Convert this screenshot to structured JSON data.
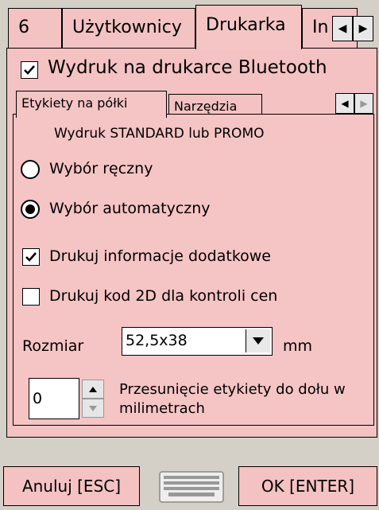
{
  "outer_tabs": [
    "6",
    "Użytkownicy",
    "Drukarka",
    "In"
  ],
  "bluetooth_label": "Wydruk na drukarce Bluetooth",
  "inner_tabs": [
    "Etykiety na półki",
    "Narzędzia"
  ],
  "section_title": "Wydruk STANDARD lub PROMO",
  "radio_manual": "Wybór ręczny",
  "radio_auto": "Wybór automatyczny",
  "check_extra_info": "Drukuj informacje dodatkowe",
  "check_2d_code": "Drukuj kod 2D dla kontroli cen",
  "size_label": "Rozmiar",
  "size_value": "52,5x38",
  "size_unit": "mm",
  "offset_value": "0",
  "offset_label": "Przesunięcie etykiety do dołu w milimetrach",
  "cancel_label": "Anuluj [ESC]",
  "ok_label": "OK [ENTER]",
  "colors": {
    "panel": "#f4c2c2",
    "chrome": "#d4d0c8"
  },
  "state": {
    "bluetooth_checked": true,
    "radio_selected": "auto",
    "extra_info_checked": true,
    "code_2d_checked": false
  }
}
